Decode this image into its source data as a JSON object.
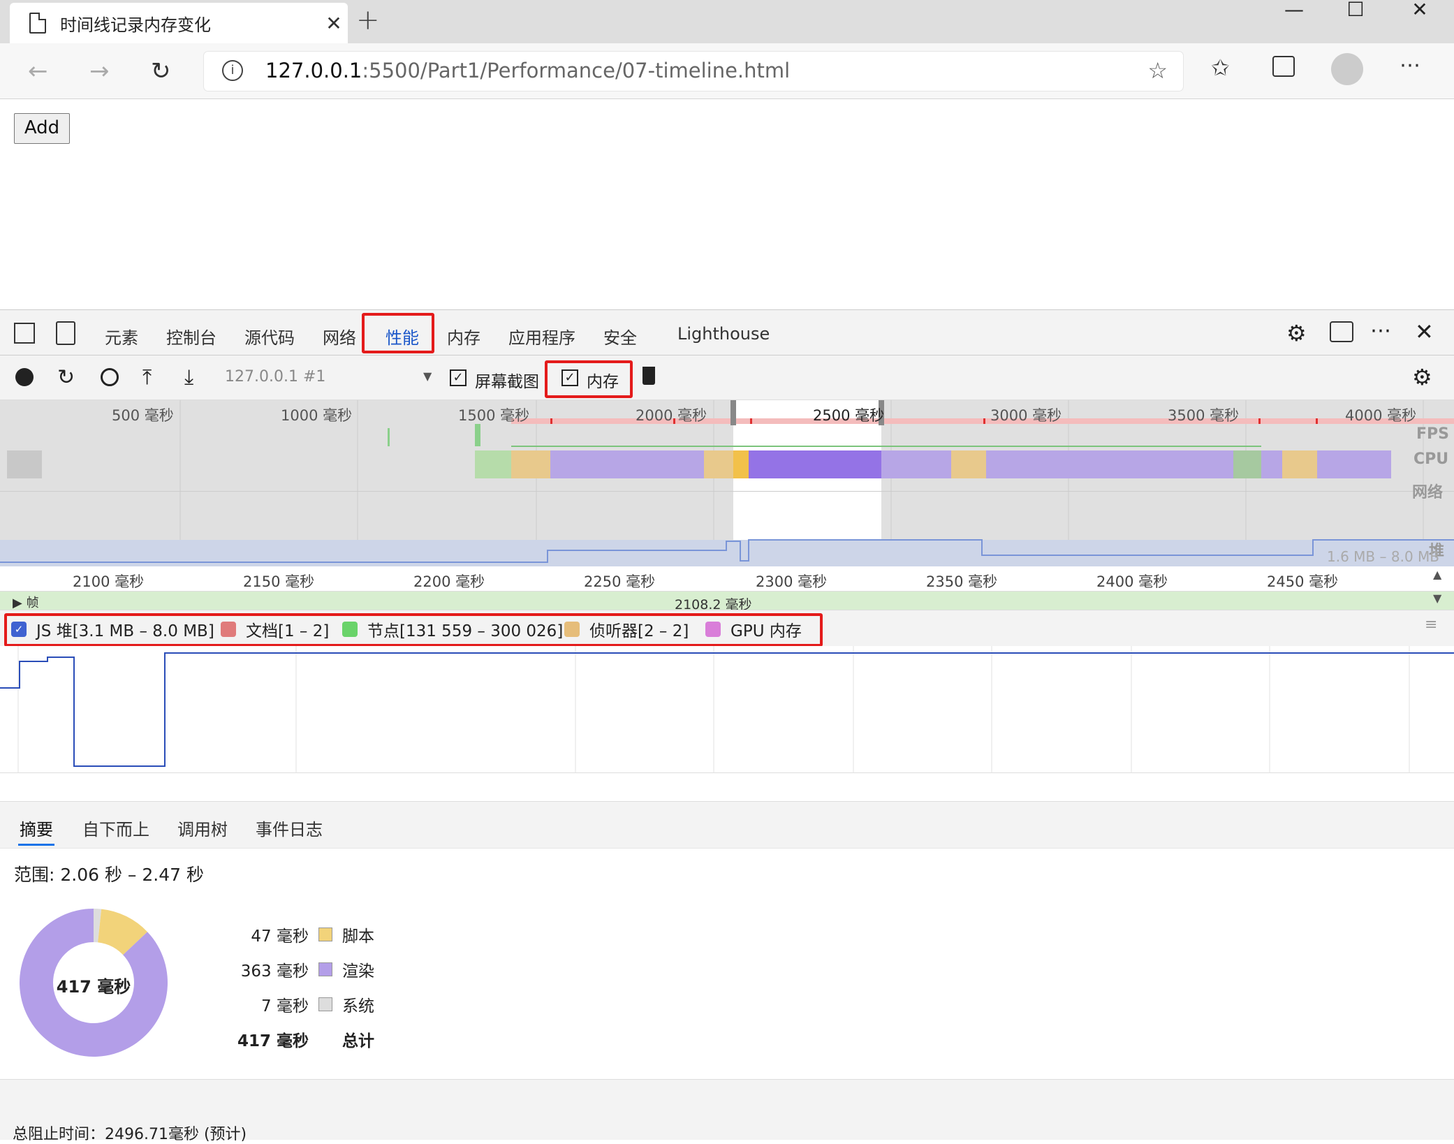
{
  "browser": {
    "tab_title": "时间线记录内存变化",
    "url_host": "127.0.0.1",
    "url_path": ":5500/Part1/Performance/07-timeline.html"
  },
  "page": {
    "add_label": "Add"
  },
  "devtools": {
    "tabs": [
      "元素",
      "控制台",
      "源代码",
      "网络",
      "性能",
      "内存",
      "应用程序",
      "安全",
      "Lighthouse"
    ],
    "active_tab": "性能"
  },
  "perf_toolbar": {
    "target": "127.0.0.1 #1",
    "screenshots_label": "屏幕截图",
    "memory_label": "内存"
  },
  "overview": {
    "ticks": [
      "500 毫秒",
      "1000 毫秒",
      "1500 毫秒",
      "2000 毫秒",
      "2500 毫秒",
      "3000 毫秒",
      "3500 毫秒",
      "4000 毫秒"
    ],
    "labels": {
      "fps": "FPS",
      "cpu": "CPU",
      "net": "网络",
      "heap": "堆"
    },
    "heap_range": "1.6 MB – 8.0 MB"
  },
  "ruler": {
    "ticks": [
      "2100 毫秒",
      "2150 毫秒",
      "2200 毫秒",
      "2250 毫秒",
      "2300 毫秒",
      "2350 毫秒",
      "2400 毫秒",
      "2450 毫秒"
    ],
    "frames_label": "帧",
    "frame_value": "2108.2 毫秒"
  },
  "legend": [
    {
      "label": "JS 堆[3.1 MB – 8.0 MB]",
      "color": "#3f62d1",
      "checked": true
    },
    {
      "label": "文档[1 – 2]",
      "color": "#e07b7b",
      "checked": false
    },
    {
      "label": "节点[131 559 – 300 026]",
      "color": "#6ad36a",
      "checked": false
    },
    {
      "label": "侦听器[2 – 2]",
      "color": "#e6bd7a",
      "checked": false
    },
    {
      "label": "GPU 内存",
      "color": "#d97ed9",
      "checked": false
    }
  ],
  "bottom_tabs": [
    "摘要",
    "自下而上",
    "调用树",
    "事件日志"
  ],
  "summary": {
    "range": "范围: 2.06 秒 – 2.47 秒",
    "total_center": "417 毫秒",
    "rows": [
      {
        "value": "47 毫秒",
        "label": "脚本",
        "color": "#f2d37a"
      },
      {
        "value": "363 毫秒",
        "label": "渲染",
        "color": "#b39ee8"
      },
      {
        "value": "7 毫秒",
        "label": "系统",
        "color": "#dddddd"
      }
    ],
    "total_value": "417 毫秒",
    "total_label": "总计"
  },
  "footer": {
    "blocking": "总阻止时间：2496.71毫秒 (预计)"
  },
  "chart_data": {
    "type": "pie",
    "categories": [
      "脚本",
      "渲染",
      "系统"
    ],
    "values": [
      47,
      363,
      7
    ],
    "colors": [
      "#f2d37a",
      "#b39ee8",
      "#dddddd"
    ],
    "total": "417 毫秒"
  }
}
